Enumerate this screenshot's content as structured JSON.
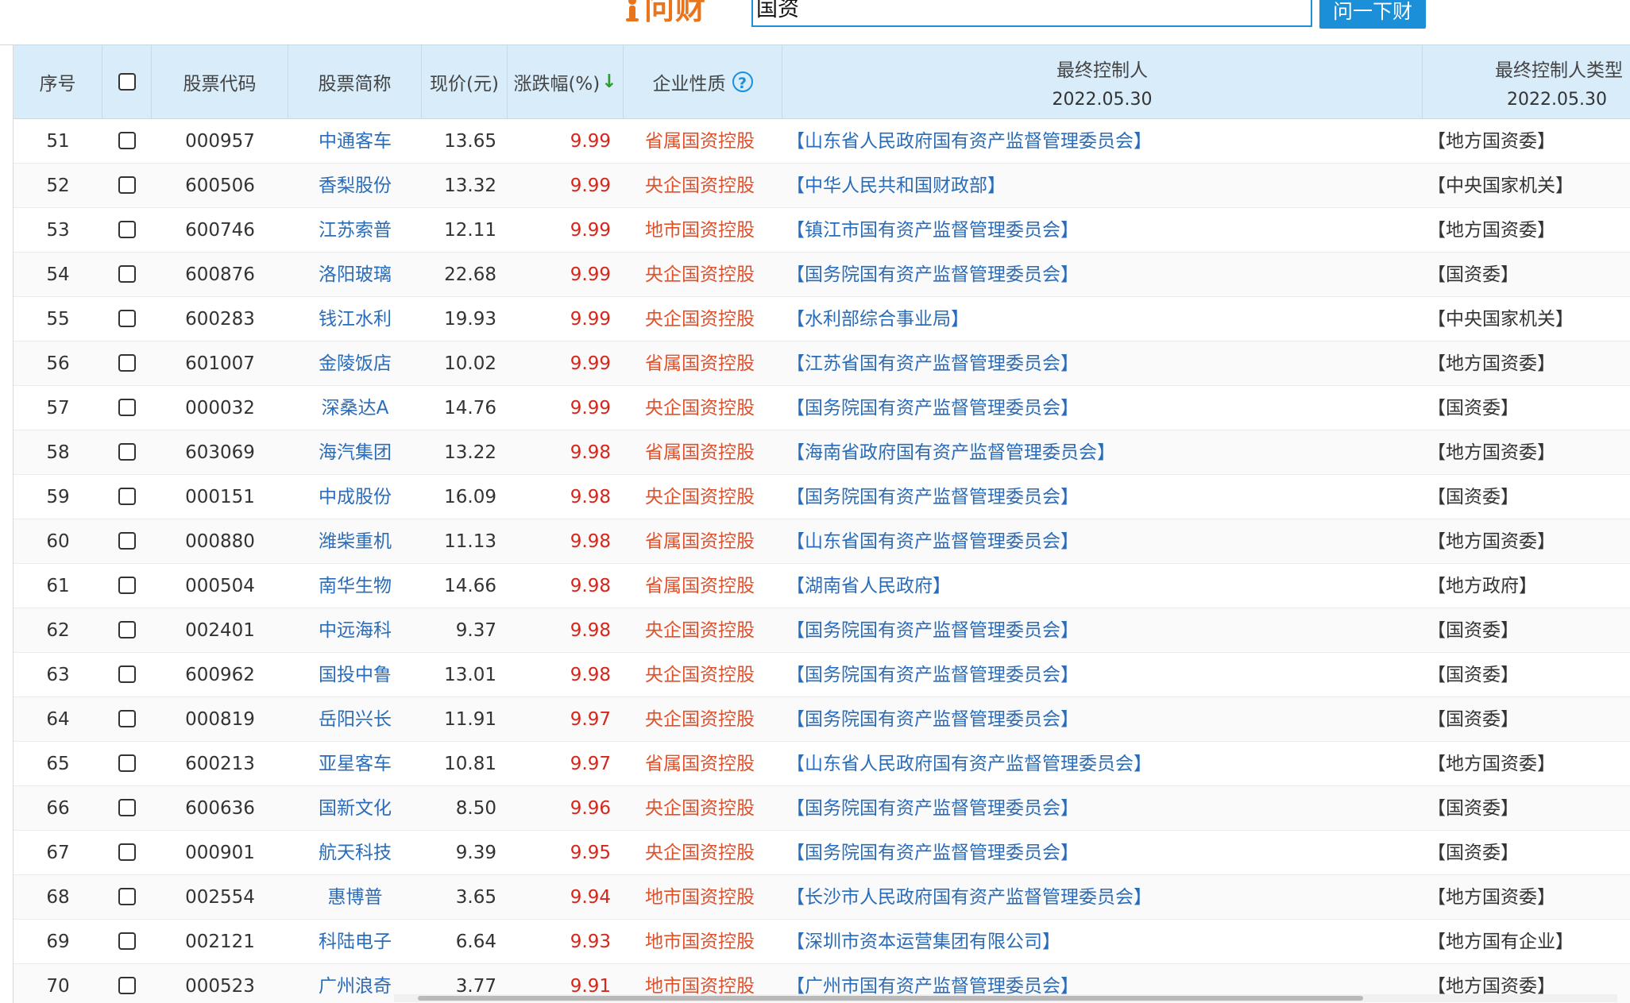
{
  "header": {
    "logo_text": "问财",
    "search_value": "国资",
    "search_button": "问一下财"
  },
  "colors": {
    "accent": "#1b8fd7",
    "logo": "#e8741c",
    "rise": "#d4271d",
    "link": "#2a6cb8",
    "header_bg": "#d8ecfa"
  },
  "table": {
    "columns": {
      "seq": "序号",
      "code": "股票代码",
      "name": "股票简称",
      "price": "现价(元)",
      "change": "涨跌幅(%)",
      "sort_arrow": "↓",
      "nature": "企业性质",
      "help_icon": "?",
      "controller": "最终控制人",
      "controller_date": "2022.05.30",
      "controller_type": "最终控制人类型",
      "controller_type_date": "2022.05.30"
    },
    "rows": [
      {
        "seq": "51",
        "code": "000957",
        "name": "中通客车",
        "price": "13.65",
        "change": "9.99",
        "nature": "省属国资控股",
        "controller": "【山东省人民政府国有资产监督管理委员会】",
        "type": "【地方国资委】"
      },
      {
        "seq": "52",
        "code": "600506",
        "name": "香梨股份",
        "price": "13.32",
        "change": "9.99",
        "nature": "央企国资控股",
        "controller": "【中华人民共和国财政部】",
        "type": "【中央国家机关】"
      },
      {
        "seq": "53",
        "code": "600746",
        "name": "江苏索普",
        "price": "12.11",
        "change": "9.99",
        "nature": "地市国资控股",
        "controller": "【镇江市国有资产监督管理委员会】",
        "type": "【地方国资委】"
      },
      {
        "seq": "54",
        "code": "600876",
        "name": "洛阳玻璃",
        "price": "22.68",
        "change": "9.99",
        "nature": "央企国资控股",
        "controller": "【国务院国有资产监督管理委员会】",
        "type": "【国资委】"
      },
      {
        "seq": "55",
        "code": "600283",
        "name": "钱江水利",
        "price": "19.93",
        "change": "9.99",
        "nature": "央企国资控股",
        "controller": "【水利部综合事业局】",
        "type": "【中央国家机关】"
      },
      {
        "seq": "56",
        "code": "601007",
        "name": "金陵饭店",
        "price": "10.02",
        "change": "9.99",
        "nature": "省属国资控股",
        "controller": "【江苏省国有资产监督管理委员会】",
        "type": "【地方国资委】"
      },
      {
        "seq": "57",
        "code": "000032",
        "name": "深桑达A",
        "price": "14.76",
        "change": "9.99",
        "nature": "央企国资控股",
        "controller": "【国务院国有资产监督管理委员会】",
        "type": "【国资委】"
      },
      {
        "seq": "58",
        "code": "603069",
        "name": "海汽集团",
        "price": "13.22",
        "change": "9.98",
        "nature": "省属国资控股",
        "controller": "【海南省政府国有资产监督管理委员会】",
        "type": "【地方国资委】"
      },
      {
        "seq": "59",
        "code": "000151",
        "name": "中成股份",
        "price": "16.09",
        "change": "9.98",
        "nature": "央企国资控股",
        "controller": "【国务院国有资产监督管理委员会】",
        "type": "【国资委】"
      },
      {
        "seq": "60",
        "code": "000880",
        "name": "潍柴重机",
        "price": "11.13",
        "change": "9.98",
        "nature": "省属国资控股",
        "controller": "【山东省国有资产监督管理委员会】",
        "type": "【地方国资委】"
      },
      {
        "seq": "61",
        "code": "000504",
        "name": "南华生物",
        "price": "14.66",
        "change": "9.98",
        "nature": "省属国资控股",
        "controller": "【湖南省人民政府】",
        "type": "【地方政府】"
      },
      {
        "seq": "62",
        "code": "002401",
        "name": "中远海科",
        "price": "9.37",
        "change": "9.98",
        "nature": "央企国资控股",
        "controller": "【国务院国有资产监督管理委员会】",
        "type": "【国资委】"
      },
      {
        "seq": "63",
        "code": "600962",
        "name": "国投中鲁",
        "price": "13.01",
        "change": "9.98",
        "nature": "央企国资控股",
        "controller": "【国务院国有资产监督管理委员会】",
        "type": "【国资委】"
      },
      {
        "seq": "64",
        "code": "000819",
        "name": "岳阳兴长",
        "price": "11.91",
        "change": "9.97",
        "nature": "央企国资控股",
        "controller": "【国务院国有资产监督管理委员会】",
        "type": "【国资委】"
      },
      {
        "seq": "65",
        "code": "600213",
        "name": "亚星客车",
        "price": "10.81",
        "change": "9.97",
        "nature": "省属国资控股",
        "controller": "【山东省人民政府国有资产监督管理委员会】",
        "type": "【地方国资委】"
      },
      {
        "seq": "66",
        "code": "600636",
        "name": "国新文化",
        "price": "8.50",
        "change": "9.96",
        "nature": "央企国资控股",
        "controller": "【国务院国有资产监督管理委员会】",
        "type": "【国资委】"
      },
      {
        "seq": "67",
        "code": "000901",
        "name": "航天科技",
        "price": "9.39",
        "change": "9.95",
        "nature": "央企国资控股",
        "controller": "【国务院国有资产监督管理委员会】",
        "type": "【国资委】"
      },
      {
        "seq": "68",
        "code": "002554",
        "name": "惠博普",
        "price": "3.65",
        "change": "9.94",
        "nature": "地市国资控股",
        "controller": "【长沙市人民政府国有资产监督管理委员会】",
        "type": "【地方国资委】"
      },
      {
        "seq": "69",
        "code": "002121",
        "name": "科陆电子",
        "price": "6.64",
        "change": "9.93",
        "nature": "地市国资控股",
        "controller": "【深圳市资本运营集团有限公司】",
        "type": "【地方国有企业】"
      },
      {
        "seq": "70",
        "code": "000523",
        "name": "广州浪奇",
        "price": "3.77",
        "change": "9.91",
        "nature": "地市国资控股",
        "controller": "【广州市国有资产监督管理委员会】",
        "type": "【地方国资委】"
      }
    ]
  }
}
